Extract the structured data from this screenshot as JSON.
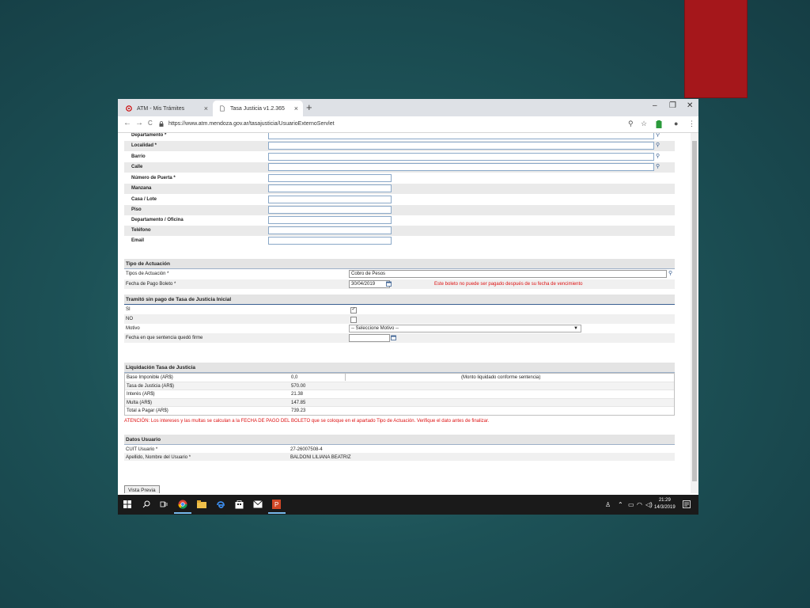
{
  "browser": {
    "tabs": [
      {
        "label": "ATM - Mis Trámites",
        "close": "×"
      },
      {
        "label": "Tasa Justicia v1.2.365",
        "close": "×"
      }
    ],
    "new_tab": "+",
    "window_controls": {
      "minimize": "–",
      "maximize": "❐",
      "close": "✕"
    },
    "url": "https://www.atm.mendoza.gov.ar/tasajusticia/UsuarioExternoServlet",
    "icons": {
      "back": "←",
      "forward": "→",
      "reload": "C",
      "zoom": "⚲",
      "star": "☆",
      "profile": "●",
      "menu": "⋮"
    }
  },
  "address_fields": [
    {
      "label": "Departamento *",
      "value": "",
      "search": "⚲",
      "wide": true
    },
    {
      "label": "Localidad *",
      "value": "",
      "search": "⚲",
      "wide": true
    },
    {
      "label": "Barrio",
      "value": "",
      "search": "⚲",
      "wide": true
    },
    {
      "label": "Calle",
      "value": "",
      "search": "⚲",
      "wide": true
    },
    {
      "label": "Número de Puerta *",
      "value": "",
      "wide": false
    },
    {
      "label": "Manzana",
      "value": "",
      "wide": false
    },
    {
      "label": "Casa / Lote",
      "value": "",
      "wide": false
    },
    {
      "label": "Piso",
      "value": "",
      "wide": false
    },
    {
      "label": "Departamento / Oficina",
      "value": "",
      "wide": false
    },
    {
      "label": "Teléfono",
      "value": "",
      "wide": false
    },
    {
      "label": "Email",
      "value": "",
      "wide": false
    }
  ],
  "tipo_actuacion": {
    "title": "Tipo de Actuación",
    "tipos_label": "Tipos de Actuación *",
    "tipos_value": "Cobro de Pesos",
    "fecha_label": "Fecha de Pago Boleto *",
    "fecha_value": "30/04/2019",
    "warning": "Este boleto no puede ser pagado después de su fecha de vencimiento"
  },
  "tramito": {
    "title": "Tramitó sin pago de Tasa de Justicia Inicial",
    "si_label": "SI",
    "si_checked": "✓",
    "no_label": "NO",
    "motivo_label": "Motivo",
    "motivo_value": "-- Seleccione Motivo --",
    "fecha_sentencia_label": "Fecha en que sentencia quedó firme"
  },
  "liquidacion": {
    "title": "Liquidación Tasa de Justicia",
    "monto_note": "(Monto liquidado conforme sentencia)",
    "rows": [
      {
        "label": "Base Imponible (AR$)",
        "value": "0,0"
      },
      {
        "label": "Tasa de Justicia (AR$)",
        "value": "570.00"
      },
      {
        "label": "Interés (AR$)",
        "value": "21.38"
      },
      {
        "label": "Multa (AR$)",
        "value": "147.85"
      },
      {
        "label": "Total a Pagar (AR$)",
        "value": "739.23"
      }
    ],
    "attention": "ATENCIÓN: Los intereses y las multas se calculan a la FECHA DE PAGO DEL BOLETO que se coloque en el apartado Tipo de Actuación. Verifique el dato antes de finalizar."
  },
  "usuario": {
    "title": "Datos Usuario",
    "cuit_label": "CUIT Usuario *",
    "cuit_value": "27-26007508-4",
    "nombre_label": "Apellido, Nombre del Usuario *",
    "nombre_value": "BALDONI LILIANA BEATRIZ"
  },
  "buttons": {
    "vista_previa": "Vista Previa"
  },
  "taskbar": {
    "icons": [
      "windows-icon",
      "search-icon",
      "task-view-icon",
      "chrome-icon",
      "file-explorer-icon",
      "edge-icon",
      "store-icon",
      "mail-icon",
      "powerpoint-icon"
    ],
    "time": "21:29",
    "date": "14/3/2019"
  },
  "colors": {
    "accent_red": "#a5171b",
    "link_blue": "#3a5f91",
    "warning_red": "#dd1111"
  }
}
